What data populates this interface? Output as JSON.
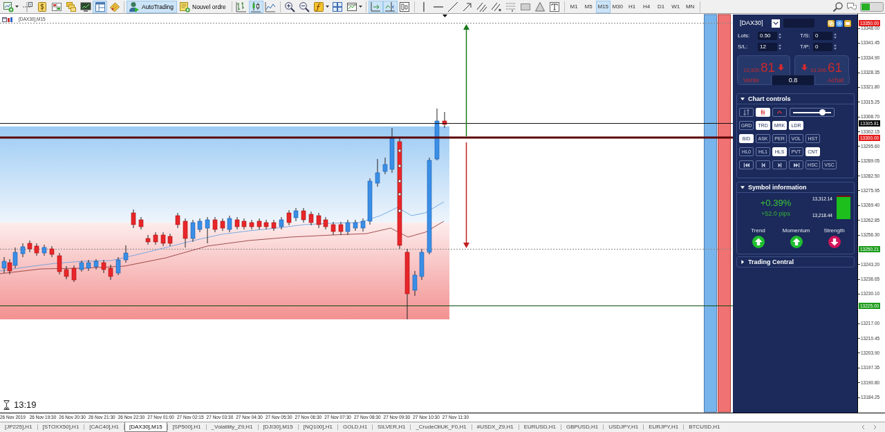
{
  "toolbar": {
    "left_buttons": [
      {
        "selected": false
      },
      {
        "selected": false
      },
      {
        "selected": false
      },
      {
        "selected": false
      },
      {
        "selected": false
      },
      {
        "selected": false
      },
      {
        "selected": true
      },
      {
        "selected": false
      }
    ],
    "auto_trading": {
      "label": "AutoTrading",
      "on": true
    },
    "new_order": {
      "label": "Nouvel ordre"
    },
    "chart_types": [
      {
        "selected": false
      },
      {
        "selected": true
      },
      {
        "selected": false
      }
    ],
    "view_buttons": [
      {
        "selected": false
      },
      {
        "selected": false
      },
      {
        "selected": false
      },
      {
        "selected": false
      },
      {
        "selected": false
      }
    ],
    "scroll_buttons": [
      {
        "selected": true
      },
      {
        "selected": true
      },
      {
        "selected": false
      }
    ],
    "drawing_tools": [
      {
        "selected": false
      },
      {
        "selected": false
      },
      {
        "selected": false
      },
      {
        "selected": false
      },
      {
        "selected": false
      },
      {
        "selected": false
      },
      {
        "selected": false
      },
      {
        "selected": false
      },
      {
        "selected": false
      },
      {
        "selected": false
      }
    ],
    "timeframes": [
      {
        "label": "M1",
        "selected": false
      },
      {
        "label": "M5",
        "selected": false
      },
      {
        "label": "M15",
        "selected": true
      },
      {
        "label": "M30",
        "selected": false
      },
      {
        "label": "H1",
        "selected": false
      },
      {
        "label": "H4",
        "selected": false
      },
      {
        "label": "D1",
        "selected": false
      },
      {
        "label": "W1",
        "selected": false
      },
      {
        "label": "MN",
        "selected": false
      }
    ]
  },
  "chart": {
    "title": "[DAX30],M15",
    "countdown": "13:19"
  },
  "trade_panel": {
    "symbol": "[DAX30]",
    "fields": [
      {
        "label": "Lots:",
        "value": "0.50"
      },
      {
        "label": "T/S:",
        "value": "0"
      },
      {
        "label": "S/L:",
        "value": "12"
      },
      {
        "label": "T/P:",
        "value": "0"
      }
    ],
    "sell": {
      "price_small": "13,305.",
      "price_big": "81",
      "rising": false,
      "label": "Vente"
    },
    "spread": "0.8",
    "buy": {
      "price_small": "13,306.",
      "price_big": "61",
      "rising": false,
      "label": "Achat"
    },
    "chart_controls": {
      "title": "Chart controls",
      "expanded": true,
      "style_buttons": [
        {
          "on": false
        },
        {
          "on": true
        },
        {
          "on": false
        }
      ],
      "zoom_slider": {
        "level": 0.78
      },
      "toggle_rows": [
        [
          {
            "label": "GRD",
            "on": false
          },
          {
            "label": "TRD",
            "on": true
          },
          {
            "label": "MRK",
            "on": true
          },
          {
            "label": "LDR",
            "on": true
          }
        ],
        [
          {
            "label": "BID",
            "on": true
          },
          {
            "label": "ASK",
            "on": false
          },
          {
            "label": "PER",
            "on": false
          },
          {
            "label": "VOL",
            "on": false
          },
          {
            "label": "HST",
            "on": false
          }
        ],
        [
          {
            "label": "HL0",
            "on": false
          },
          {
            "label": "HL1",
            "on": false
          },
          {
            "label": "HLS",
            "on": true
          },
          {
            "label": "PVT",
            "on": false
          },
          {
            "label": "CNT",
            "on": true
          }
        ]
      ],
      "scale_buttons": [
        {
          "label": "HSC",
          "on": false
        },
        {
          "label": "VSC",
          "on": false
        }
      ]
    },
    "symbol_information": {
      "title": "Symbol information",
      "expanded": true,
      "change_percent": "+0.39%",
      "change_pips": "+52.0 pips",
      "high": "13,312.14",
      "low": "13,218.44",
      "range_bar": {
        "level": 0.94
      },
      "signals": [
        {
          "label": "Trend",
          "rising": true
        },
        {
          "label": "Momentum",
          "rising": true
        },
        {
          "label": "Strength",
          "rising": false
        }
      ]
    },
    "trading_central": {
      "title": "Trading Central",
      "expanded": false
    }
  },
  "price_axis": {
    "ticks": [
      "13348.00",
      "13341.45",
      "13334.90",
      "13328.35",
      "13321.80",
      "13315.25",
      "13308.70",
      "13302.15",
      "13295.60",
      "13289.05",
      "13282.50",
      "13275.95",
      "13269.40",
      "13262.85",
      "13256.30",
      "13243.20",
      "13236.65",
      "13230.10",
      "13217.00",
      "13210.45",
      "13203.90",
      "13197.35",
      "13190.80",
      "13184.25"
    ],
    "badges": [
      {
        "text": "13350.00",
        "color": "#e41b1b"
      },
      {
        "text": "13305.81",
        "color": "#000000"
      },
      {
        "text": "13300.00",
        "color": "#e41b1b"
      },
      {
        "text": "13250.21",
        "color": "#1c9c1c"
      },
      {
        "text": "13225.00",
        "color": "#1c9c1c"
      }
    ]
  },
  "time_axis": {
    "labels": [
      "26 Nov 2019",
      "26 Nov 19:30",
      "26 Nov 20:30",
      "26 Nov 21:30",
      "26 Nov 22:30",
      "27 Nov 01:00",
      "27 Nov 02:15",
      "27 Nov 03:30",
      "27 Nov 04:30",
      "27 Nov 05:30",
      "27 Nov 06:30",
      "27 Nov 07:30",
      "27 Nov 08:30",
      "27 Nov 09:30",
      "27 Nov 10:30",
      "27 Nov 11:30"
    ]
  },
  "tabs": [
    {
      "label": "[JP225],H1",
      "selected": false
    },
    {
      "label": "[STOXX50],H1",
      "selected": false
    },
    {
      "label": "[CAC40],H1",
      "selected": false
    },
    {
      "label": "[DAX30],M15",
      "selected": true
    },
    {
      "label": "[SP500],H1",
      "selected": false
    },
    {
      "label": "_Volatility_Z9,H1",
      "selected": false
    },
    {
      "label": "[DJI30],M15",
      "selected": false
    },
    {
      "label": "[NQ100],H1",
      "selected": false
    },
    {
      "label": "GOLD,H1",
      "selected": false
    },
    {
      "label": "SILVER,H1",
      "selected": false
    },
    {
      "label": "_CrudeOilUK_F0,H1",
      "selected": false
    },
    {
      "label": "#USDX_Z9,H1",
      "selected": false
    },
    {
      "label": "EURUSD,H1",
      "selected": false
    },
    {
      "label": "GBPUSD,H1",
      "selected": false
    },
    {
      "label": "USDJPY,H1",
      "selected": false
    },
    {
      "label": "EURJPY,H1",
      "selected": false
    },
    {
      "label": "BTCUSD,H1",
      "selected": false
    }
  ]
}
